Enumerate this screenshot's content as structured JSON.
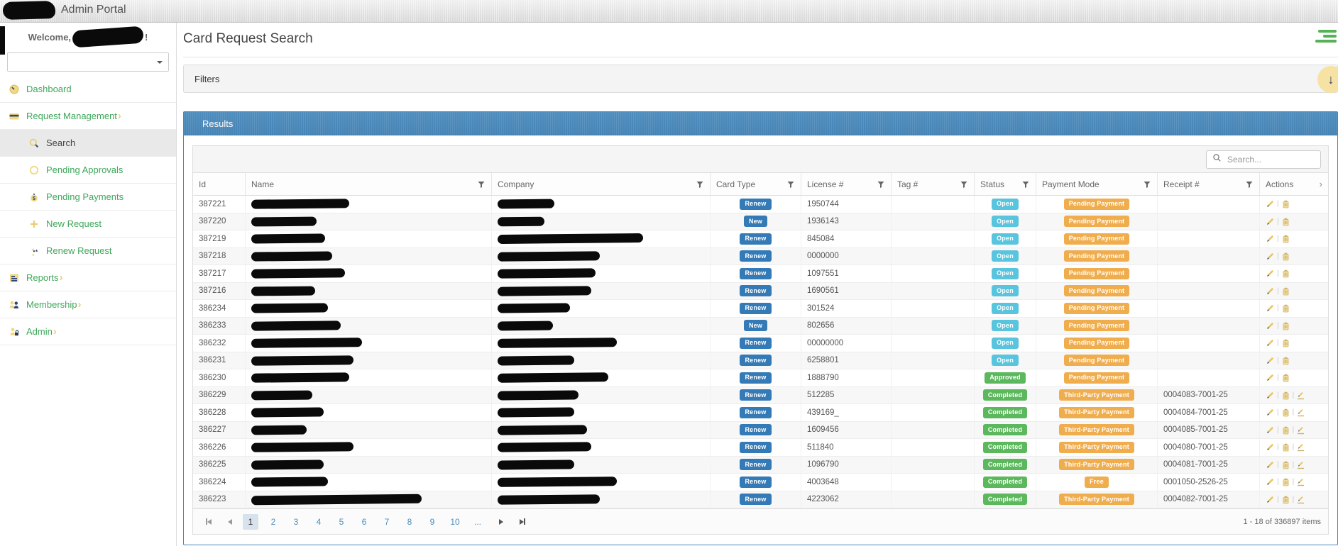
{
  "colors": {
    "sidebar_green": "#3fa75a",
    "icon_yellow": "#f0d884",
    "icon_navy": "#2e4772",
    "results_bar_blue": "#4a87b8",
    "card_type_blue": "#337ab7",
    "status_open_blue": "#58c4dd",
    "status_done_green": "#5cb85c",
    "payment_orange": "#f0ad4e",
    "hamburger_green": "#56b157",
    "filters_button_yellow": "#f6e3a4"
  },
  "header": {
    "title": "Admin Portal"
  },
  "sidebar": {
    "welcome_prefix": "Welcome,",
    "welcome_suffix": "!",
    "menu": [
      {
        "label": "Dashboard",
        "icon": "gauge-icon",
        "expandable": false,
        "sub": false,
        "selected": false
      },
      {
        "label": "Request Management",
        "icon": "card-icon",
        "expandable": true,
        "sub": false,
        "selected": false
      },
      {
        "label": "Search",
        "icon": "search-icon",
        "expandable": false,
        "sub": true,
        "selected": true
      },
      {
        "label": "Pending Approvals",
        "icon": "circle-icon",
        "expandable": false,
        "sub": true,
        "selected": false
      },
      {
        "label": "Pending Payments",
        "icon": "money-bag-icon",
        "expandable": false,
        "sub": true,
        "selected": false
      },
      {
        "label": "New Request",
        "icon": "plus-icon",
        "expandable": false,
        "sub": true,
        "selected": false
      },
      {
        "label": "Renew Request",
        "icon": "renew-icon",
        "expandable": false,
        "sub": true,
        "selected": false
      },
      {
        "label": "Reports",
        "icon": "report-icon",
        "expandable": true,
        "sub": false,
        "selected": false
      },
      {
        "label": "Membership",
        "icon": "members-icon",
        "expandable": true,
        "sub": false,
        "selected": false
      },
      {
        "label": "Admin",
        "icon": "admin-icon",
        "expandable": true,
        "sub": false,
        "selected": false
      }
    ]
  },
  "main": {
    "page_title": "Card Request Search",
    "filters": {
      "title": "Filters"
    },
    "results": {
      "title": "Results",
      "search_placeholder": "Search...",
      "columns": [
        {
          "key": "id",
          "label": "Id",
          "filter": false
        },
        {
          "key": "name",
          "label": "Name",
          "filter": true
        },
        {
          "key": "company",
          "label": "Company",
          "filter": true
        },
        {
          "key": "card",
          "label": "Card Type",
          "filter": true
        },
        {
          "key": "license",
          "label": "License #",
          "filter": true
        },
        {
          "key": "tag",
          "label": "Tag #",
          "filter": true
        },
        {
          "key": "status",
          "label": "Status",
          "filter": true
        },
        {
          "key": "payment",
          "label": "Payment Mode",
          "filter": true
        },
        {
          "key": "receipt",
          "label": "Receipt #",
          "filter": true
        },
        {
          "key": "actions",
          "label": "Actions",
          "filter": false,
          "chevron": true
        }
      ],
      "rows": [
        {
          "id": "387221",
          "card_type": "Renew",
          "license": "1950744",
          "tag": "",
          "status": "Open",
          "payment": "Pending Payment",
          "receipt": "",
          "sign": false,
          "name_w": 138,
          "company_w": 80
        },
        {
          "id": "387220",
          "card_type": "New",
          "license": "1936143",
          "tag": "",
          "status": "Open",
          "payment": "Pending Payment",
          "receipt": "",
          "sign": false,
          "name_w": 92,
          "company_w": 66
        },
        {
          "id": "387219",
          "card_type": "Renew",
          "license": "845084",
          "tag": "",
          "status": "Open",
          "payment": "Pending Payment",
          "receipt": "",
          "sign": false,
          "name_w": 104,
          "company_w": 205
        },
        {
          "id": "387218",
          "card_type": "Renew",
          "license": "0000000",
          "tag": "",
          "status": "Open",
          "payment": "Pending Payment",
          "receipt": "",
          "sign": false,
          "name_w": 114,
          "company_w": 144
        },
        {
          "id": "387217",
          "card_type": "Renew",
          "license": "1097551",
          "tag": "",
          "status": "Open",
          "payment": "Pending Payment",
          "receipt": "",
          "sign": false,
          "name_w": 132,
          "company_w": 138
        },
        {
          "id": "387216",
          "card_type": "Renew",
          "license": "1690561",
          "tag": "",
          "status": "Open",
          "payment": "Pending Payment",
          "receipt": "",
          "sign": false,
          "name_w": 90,
          "company_w": 132
        },
        {
          "id": "386234",
          "card_type": "Renew",
          "license": "301524",
          "tag": "",
          "status": "Open",
          "payment": "Pending Payment",
          "receipt": "",
          "sign": false,
          "name_w": 108,
          "company_w": 102
        },
        {
          "id": "386233",
          "card_type": "New",
          "license": "802656",
          "tag": "",
          "status": "Open",
          "payment": "Pending Payment",
          "receipt": "",
          "sign": false,
          "name_w": 126,
          "company_w": 78
        },
        {
          "id": "386232",
          "card_type": "Renew",
          "license": "00000000",
          "tag": "",
          "status": "Open",
          "payment": "Pending Payment",
          "receipt": "",
          "sign": false,
          "name_w": 156,
          "company_w": 168
        },
        {
          "id": "386231",
          "card_type": "Renew",
          "license": "6258801",
          "tag": "",
          "status": "Open",
          "payment": "Pending Payment",
          "receipt": "",
          "sign": false,
          "name_w": 144,
          "company_w": 108
        },
        {
          "id": "386230",
          "card_type": "Renew",
          "license": "1888790",
          "tag": "",
          "status": "Approved",
          "payment": "Pending Payment",
          "receipt": "",
          "sign": false,
          "name_w": 138,
          "company_w": 156
        },
        {
          "id": "386229",
          "card_type": "Renew",
          "license": "512285",
          "tag": "",
          "status": "Completed",
          "payment": "Third-Party Payment",
          "receipt": "0004083-7001-25",
          "sign": true,
          "name_w": 86,
          "company_w": 114
        },
        {
          "id": "386228",
          "card_type": "Renew",
          "license": "439169_",
          "tag": "",
          "status": "Completed",
          "payment": "Third-Party Payment",
          "receipt": "0004084-7001-25",
          "sign": true,
          "name_w": 102,
          "company_w": 108
        },
        {
          "id": "386227",
          "card_type": "Renew",
          "license": "1609456",
          "tag": "",
          "status": "Completed",
          "payment": "Third-Party Payment",
          "receipt": "0004085-7001-25",
          "sign": true,
          "name_w": 78,
          "company_w": 126
        },
        {
          "id": "386226",
          "card_type": "Renew",
          "license": "511840",
          "tag": "",
          "status": "Completed",
          "payment": "Third-Party Payment",
          "receipt": "0004080-7001-25",
          "sign": true,
          "name_w": 144,
          "company_w": 132
        },
        {
          "id": "386225",
          "card_type": "Renew",
          "license": "1096790",
          "tag": "",
          "status": "Completed",
          "payment": "Third-Party Payment",
          "receipt": "0004081-7001-25",
          "sign": true,
          "name_w": 102,
          "company_w": 108
        },
        {
          "id": "386224",
          "card_type": "Renew",
          "license": "4003648",
          "tag": "",
          "status": "Completed",
          "payment": "Free",
          "receipt": "0001050-2526-25",
          "sign": true,
          "name_w": 108,
          "company_w": 168
        },
        {
          "id": "386223",
          "card_type": "Renew",
          "license": "4223062",
          "tag": "",
          "status": "Completed",
          "payment": "Third-Party Payment",
          "receipt": "0004082-7001-25",
          "sign": true,
          "name_w": 240,
          "company_w": 144
        }
      ]
    },
    "pager": {
      "pages": [
        "1",
        "2",
        "3",
        "4",
        "5",
        "6",
        "7",
        "8",
        "9",
        "10",
        "..."
      ],
      "current": "1",
      "info": "1 - 18 of 336897 items"
    }
  }
}
